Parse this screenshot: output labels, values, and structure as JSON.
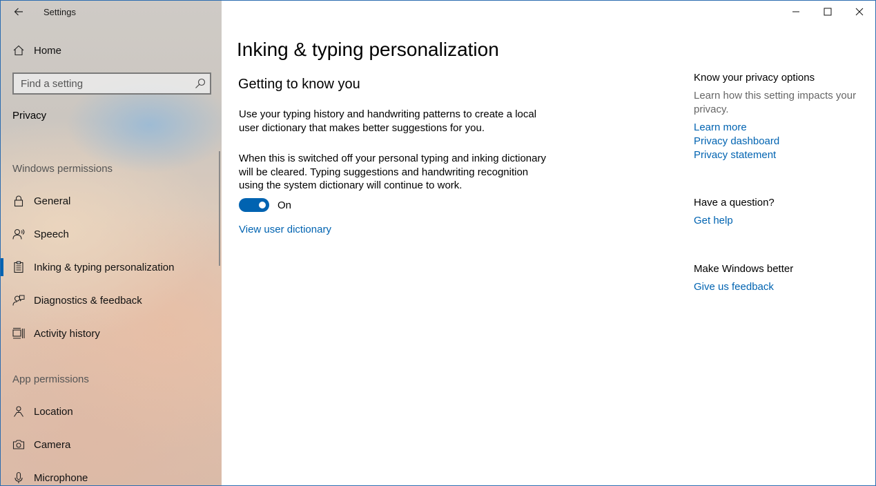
{
  "window": {
    "app_title": "Settings"
  },
  "sidebar": {
    "home_label": "Home",
    "search_placeholder": "Find a setting",
    "section_title": "Privacy",
    "groups": {
      "windows_permissions": "Windows permissions",
      "app_permissions": "App permissions"
    },
    "items": [
      {
        "label": "General",
        "icon": "lock-icon"
      },
      {
        "label": "Speech",
        "icon": "speech-icon"
      },
      {
        "label": "Inking & typing personalization",
        "icon": "inking-icon",
        "selected": true
      },
      {
        "label": "Diagnostics & feedback",
        "icon": "diagnostics-icon"
      },
      {
        "label": "Activity history",
        "icon": "activity-icon"
      },
      {
        "label": "Location",
        "icon": "location-icon"
      },
      {
        "label": "Camera",
        "icon": "camera-icon"
      },
      {
        "label": "Microphone",
        "icon": "microphone-icon"
      }
    ]
  },
  "main": {
    "page_title": "Inking & typing personalization",
    "subheading": "Getting to know you",
    "paragraph1": "Use your typing history and handwriting patterns to create a local user dictionary that makes better suggestions for you.",
    "paragraph2": "When this is switched off your personal typing and inking dictionary will be cleared. Typing suggestions and handwriting recognition using the system dictionary will continue to work.",
    "toggle_state": "On",
    "view_dictionary_link": "View user dictionary"
  },
  "related": {
    "privacy_heading": "Know your privacy options",
    "privacy_desc": "Learn how this setting impacts your privacy.",
    "learn_more": "Learn more",
    "privacy_dashboard": "Privacy dashboard",
    "privacy_statement": "Privacy statement",
    "question_heading": "Have a question?",
    "get_help": "Get help",
    "better_heading": "Make Windows better",
    "feedback": "Give us feedback"
  },
  "colors": {
    "accent": "#0063b1"
  }
}
